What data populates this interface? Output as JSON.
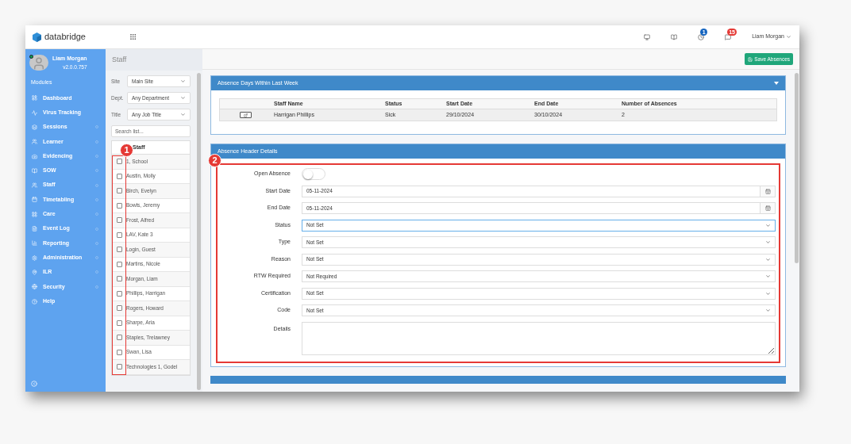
{
  "app": {
    "brand": "databridge"
  },
  "topbar": {
    "icons": [
      {
        "kind": "monitor"
      },
      {
        "kind": "book"
      },
      {
        "kind": "clock",
        "badge": "1",
        "color": "#1565c0"
      },
      {
        "kind": "chat",
        "badge": "15",
        "color": "#e53935"
      }
    ],
    "user": "Liam Morgan"
  },
  "sidebar": {
    "user": {
      "name": "Liam Morgan",
      "version": "v2.0.0.757",
      "online": true
    },
    "section": "Modules",
    "items": [
      {
        "label": "Dashboard",
        "submenu": false
      },
      {
        "label": "Virus Tracking",
        "submenu": false
      },
      {
        "label": "Sessions",
        "submenu": true
      },
      {
        "label": "Learner",
        "submenu": true
      },
      {
        "label": "Evidencing",
        "submenu": true
      },
      {
        "label": "SOW",
        "submenu": true
      },
      {
        "label": "Staff",
        "submenu": true
      },
      {
        "label": "Timetabling",
        "submenu": true
      },
      {
        "label": "Care",
        "submenu": true
      },
      {
        "label": "Event Log",
        "submenu": true
      },
      {
        "label": "Reporting",
        "submenu": true
      },
      {
        "label": "Administration",
        "submenu": true
      },
      {
        "label": "ILR",
        "submenu": true
      },
      {
        "label": "Security",
        "submenu": true
      },
      {
        "label": "Help",
        "submenu": false
      }
    ]
  },
  "staff_panel": {
    "title": "Staff",
    "filters": [
      {
        "label": "Site",
        "value": "Main Site"
      },
      {
        "label": "Dept.",
        "value": "Any Department"
      },
      {
        "label": "Title",
        "value": "Any Job Title"
      }
    ],
    "search": {
      "placeholder": "Search list..."
    },
    "list_header": "Staff",
    "rows": [
      {
        "name": "1, School",
        "checked": false
      },
      {
        "name": "Austin, Molly",
        "checked": false
      },
      {
        "name": "Birch, Evelyn",
        "checked": false
      },
      {
        "name": "Bowls, Jeremy",
        "checked": false
      },
      {
        "name": "Frost, Alfred",
        "checked": false
      },
      {
        "name": "LAV, Kate 3",
        "checked": false
      },
      {
        "name": "Login, Guest",
        "checked": false
      },
      {
        "name": "Martins, Nicole",
        "checked": false
      },
      {
        "name": "Morgan, Liam",
        "checked": false
      },
      {
        "name": "Phillips, Harrigan",
        "checked": false
      },
      {
        "name": "Rogers, Howard",
        "checked": false
      },
      {
        "name": "Sharpe, Aria",
        "checked": false
      },
      {
        "name": "Staples, Trelawney",
        "checked": false
      },
      {
        "name": "Swan, Lisa",
        "checked": false
      },
      {
        "name": "Technologies 1, Godel",
        "checked": false
      }
    ]
  },
  "toolbar": {
    "save_button": "Save Absences"
  },
  "absence_week": {
    "title": "Absence Days Within Last Week",
    "expanded": true,
    "columns": [
      "Staff Name",
      "Status",
      "Start Date",
      "End Date",
      "Number of Absences"
    ],
    "rows": [
      [
        "Harrigan Phillips",
        "Sick",
        "29/10/2024",
        "30/10/2024",
        "2"
      ]
    ]
  },
  "absence_header": {
    "title": "Absence Header Details",
    "fields": [
      {
        "kind": "toggle",
        "label": "Open Absence",
        "on": false
      },
      {
        "kind": "date",
        "label": "Start Date",
        "value": "05-11-2024"
      },
      {
        "kind": "date",
        "label": "End Date",
        "value": "05-11-2024"
      },
      {
        "kind": "select",
        "label": "Status",
        "value": "Not Set",
        "focused": true
      },
      {
        "kind": "select",
        "label": "Type",
        "value": "Not Set",
        "focused": false
      },
      {
        "kind": "select",
        "label": "Reason",
        "value": "Not Set",
        "focused": false
      },
      {
        "kind": "select",
        "label": "RTW Required",
        "value": "Not Required",
        "focused": false
      },
      {
        "kind": "select",
        "label": "Certification",
        "value": "Not Set",
        "focused": false
      },
      {
        "kind": "select",
        "label": "Code",
        "value": "Not Set",
        "focused": false
      },
      {
        "kind": "textarea",
        "label": "Details"
      }
    ]
  },
  "annotations": [
    {
      "label": "1"
    },
    {
      "label": "2"
    }
  ]
}
